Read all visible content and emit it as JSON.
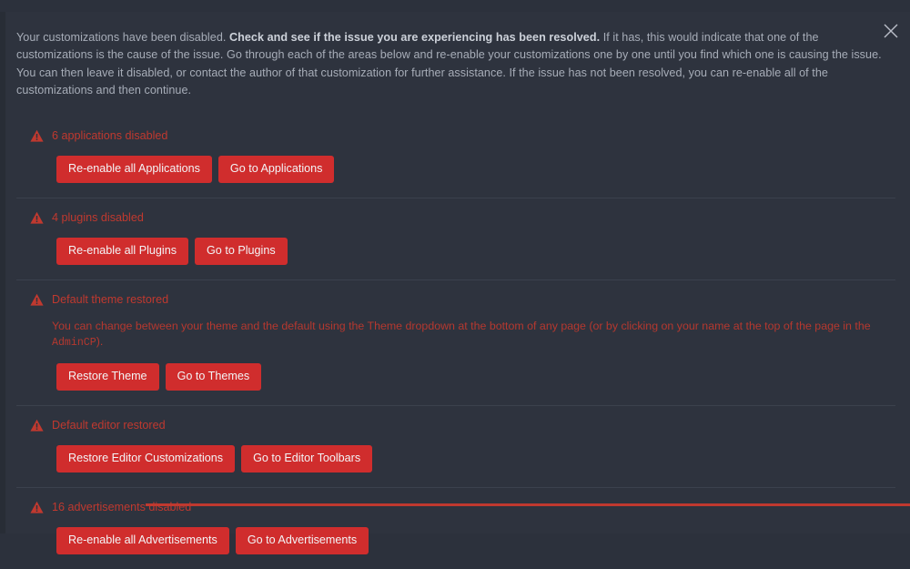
{
  "panel": {
    "accent_color": "#c0392f",
    "button_color": "#d02d2d",
    "background_color": "#2e333e",
    "text_color": "#a7adb8"
  },
  "close": {
    "icon": "close-icon",
    "label": "Close"
  },
  "intro": {
    "lead": "Your customizations have been disabled.",
    "emphasis": "Check and see if the issue you are experiencing has been resolved.",
    "rest": "If it has, this would indicate that one of the customizations is the cause of the issue. Go through each of the areas below and re-enable your customizations one by one until you find which one is causing the issue. You can then leave it disabled, or contact the author of that customization for further assistance. If the issue has not been resolved, you can re-enable all of the customizations and then continue."
  },
  "sections": [
    {
      "icon": "warning-triangle-icon",
      "title": "6 applications disabled",
      "description": "",
      "description_code": "",
      "description_tail": "",
      "buttons": [
        {
          "label": "Re-enable all Applications",
          "name": "re-enable-all-applications-button"
        },
        {
          "label": "Go to Applications",
          "name": "go-to-applications-button"
        }
      ]
    },
    {
      "icon": "warning-triangle-icon",
      "title": "4 plugins disabled",
      "description": "",
      "description_code": "",
      "description_tail": "",
      "buttons": [
        {
          "label": "Re-enable all Plugins",
          "name": "re-enable-all-plugins-button"
        },
        {
          "label": "Go to Plugins",
          "name": "go-to-plugins-button"
        }
      ]
    },
    {
      "icon": "warning-triangle-icon",
      "title": "Default theme restored",
      "description": "You can change between your theme and the default using the Theme dropdown at the bottom of any page (or by clicking on your name at the top of the page in the ",
      "description_code": "AdminCP",
      "description_tail": ").",
      "buttons": [
        {
          "label": "Restore Theme",
          "name": "restore-theme-button"
        },
        {
          "label": "Go to Themes",
          "name": "go-to-themes-button"
        }
      ]
    },
    {
      "icon": "warning-triangle-icon",
      "title": "Default editor restored",
      "description": "",
      "description_code": "",
      "description_tail": "",
      "buttons": [
        {
          "label": "Restore Editor Customizations",
          "name": "restore-editor-customizations-button"
        },
        {
          "label": "Go to Editor Toolbars",
          "name": "go-to-editor-toolbars-button"
        }
      ]
    },
    {
      "icon": "warning-triangle-icon",
      "title": "16 advertisements disabled",
      "description": "",
      "description_code": "",
      "description_tail": "",
      "buttons": [
        {
          "label": "Re-enable all Advertisements",
          "name": "re-enable-all-advertisements-button"
        },
        {
          "label": "Go to Advertisements",
          "name": "go-to-advertisements-button"
        }
      ]
    }
  ]
}
